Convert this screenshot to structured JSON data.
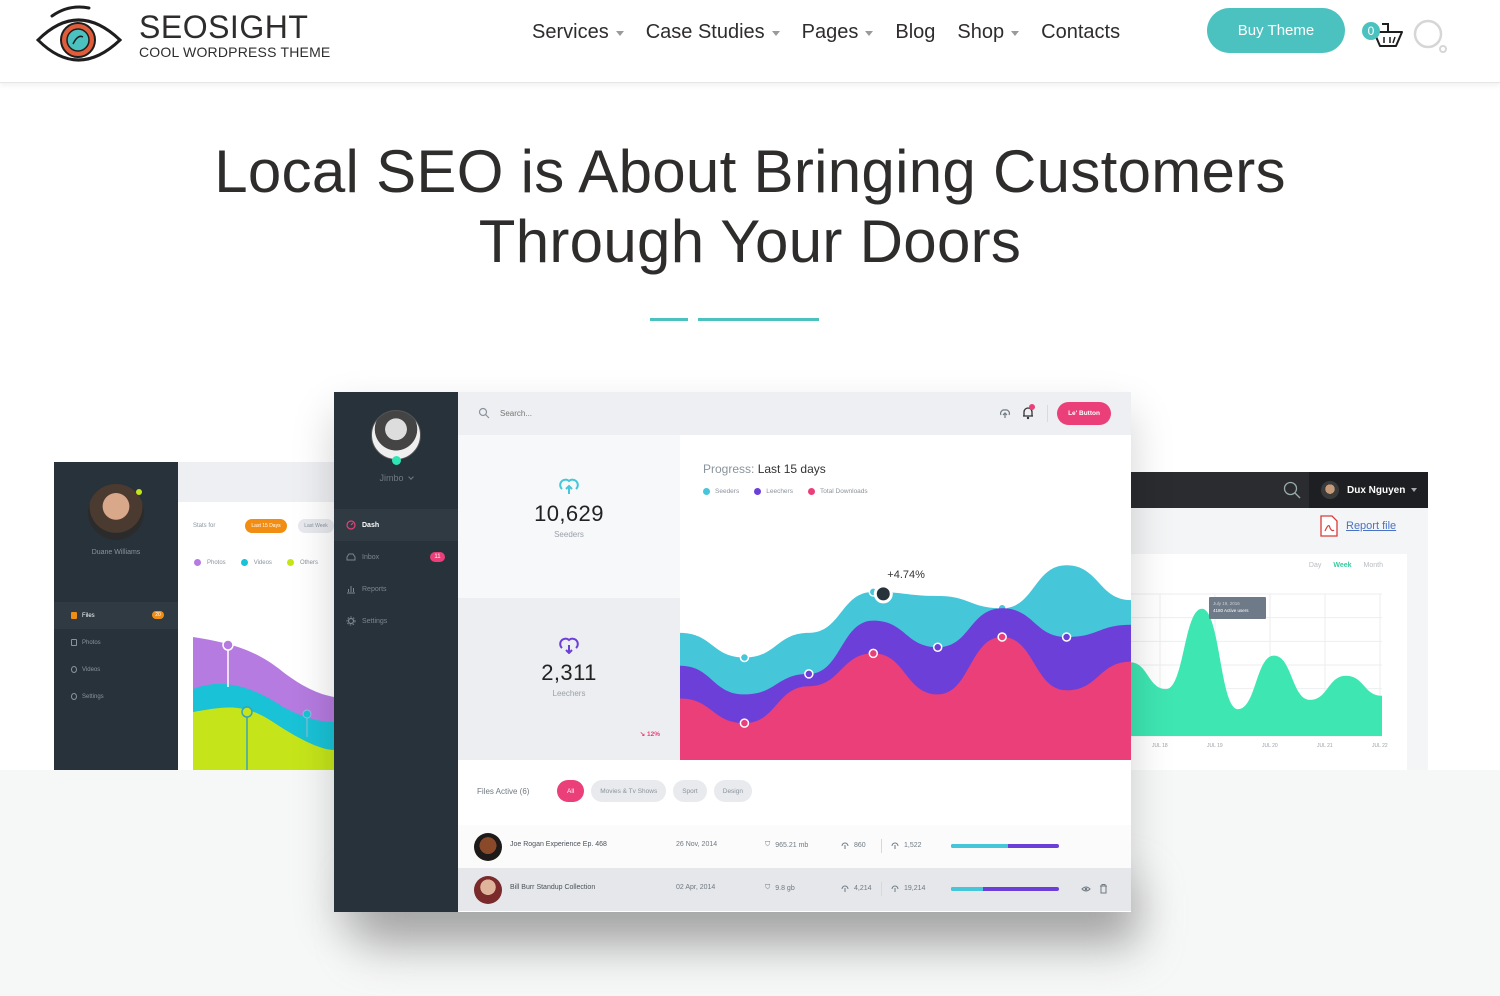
{
  "header": {
    "brand_title": "SEOSIGHT",
    "brand_subtitle": "COOL WORDPRESS THEME",
    "nav": [
      {
        "label": "Services",
        "has_dropdown": true
      },
      {
        "label": "Case Studies",
        "has_dropdown": true
      },
      {
        "label": "Pages",
        "has_dropdown": true
      },
      {
        "label": "Blog",
        "has_dropdown": false
      },
      {
        "label": "Shop",
        "has_dropdown": true
      },
      {
        "label": "Contacts",
        "has_dropdown": false
      }
    ],
    "buy_button": "Buy Theme",
    "cart_count": "0",
    "icons": {
      "cart": "basket-icon",
      "search": "search-icon",
      "logo": "eye-logo-icon"
    },
    "accent_color": "#4cc2c0"
  },
  "hero": {
    "title_line1": "Local SEO is About Bringing Customers",
    "title_line2": "Through Your Doors"
  },
  "left_mockup": {
    "user_name": "Duane Williams",
    "menu": [
      {
        "label": "Files",
        "badge": "20",
        "active": true
      },
      {
        "label": "Photos"
      },
      {
        "label": "Videos"
      },
      {
        "label": "Settings"
      }
    ],
    "stats_label": "Stats for",
    "pills": [
      "Last 15 Days",
      "Last Week"
    ],
    "legend": [
      {
        "label": "Photos",
        "color": "#b57be0"
      },
      {
        "label": "Videos",
        "color": "#19c2d6"
      },
      {
        "label": "Others",
        "color": "#c5e51a"
      }
    ]
  },
  "right_mockup": {
    "user_name": "Dux Nguyen",
    "report_link": "Report file",
    "tabs": [
      {
        "label": "Day",
        "active": false
      },
      {
        "label": "Week",
        "active": true
      },
      {
        "label": "Month",
        "active": false
      }
    ],
    "tooltip_date": "July 19, 2016",
    "tooltip_value": "4180 Active users",
    "x_labels": [
      "JUL 18",
      "JUL 19",
      "JUL 20",
      "JUL 21",
      "JUL 22"
    ],
    "series_color": "#3ee6b2",
    "active_users_relative": [
      0.55,
      0.35,
      0.95,
      0.2,
      0.6,
      0.27,
      0.45,
      0.3
    ]
  },
  "main_mockup": {
    "user_name": "Jimbo",
    "menu": [
      {
        "label": "Dash",
        "icon": "gauge-icon",
        "active": true
      },
      {
        "label": "Inbox",
        "icon": "inbox-icon",
        "badge": "11"
      },
      {
        "label": "Reports",
        "icon": "bar-chart-icon"
      },
      {
        "label": "Settings",
        "icon": "gear-icon"
      }
    ],
    "search_placeholder": "Search...",
    "action_button": "Le' Button",
    "stats": [
      {
        "value": "10,629",
        "label": "Seeders",
        "icon": "cloud-upload-icon",
        "color": "#45c6d9"
      },
      {
        "value": "2,311",
        "label": "Leechers",
        "icon": "cloud-download-icon",
        "color": "#6d3fd9",
        "trend": "12%",
        "trend_direction": "down"
      }
    ],
    "chart_title_prefix": "Progress:",
    "chart_title": "Last 15 days",
    "chart_legend": [
      {
        "label": "Seeders",
        "color": "#45c6d9"
      },
      {
        "label": "Leechers",
        "color": "#6d3fd9"
      },
      {
        "label": "Total Downloads",
        "color": "#ea3f78"
      }
    ],
    "chart_annotation": "+4.74%",
    "files_label": "Files Active (6)",
    "filters": [
      {
        "label": "All",
        "active": true
      },
      {
        "label": "Movies & Tv Shows",
        "active": false
      },
      {
        "label": "Sport",
        "active": false
      },
      {
        "label": "Design",
        "active": false
      }
    ],
    "files": [
      {
        "title": "Joe Rogan Experience Ep. 468",
        "date": "26 Nov, 2014",
        "size": "965.21 mb",
        "seeders": "860",
        "leechers": "1,522",
        "ratio": 0.53
      },
      {
        "title": "Bill Burr Standup Collection",
        "date": "02 Apr, 2014",
        "size": "9.8 gb",
        "seeders": "4,214",
        "leechers": "19,214",
        "ratio": 0.3
      }
    ]
  },
  "chart_data": [
    {
      "type": "area",
      "title": "Progress: Last 15 days",
      "legend_position": "top-left",
      "annotation": "+4.74%",
      "series": [
        {
          "name": "Seeders",
          "color": "#45c6d9",
          "values": [
            0.62,
            0.5,
            0.62,
            0.82,
            0.8,
            0.74,
            0.95,
            0.78
          ]
        },
        {
          "name": "Leechers",
          "color": "#6d3fd9",
          "values": [
            0.46,
            0.32,
            0.42,
            0.68,
            0.55,
            0.74,
            0.6,
            0.66
          ]
        },
        {
          "name": "Total Downloads",
          "color": "#ea3f78",
          "values": [
            0.3,
            0.18,
            0.36,
            0.52,
            0.32,
            0.6,
            0.34,
            0.48
          ]
        }
      ],
      "grid": false
    },
    {
      "type": "area",
      "title": "",
      "categories": [
        "JUL 18",
        "JUL 19",
        "JUL 20",
        "JUL 21",
        "JUL 22"
      ],
      "series": [
        {
          "name": "Active users",
          "values": [
            0.55,
            0.35,
            0.95,
            0.2,
            0.6,
            0.27,
            0.45,
            0.3
          ]
        }
      ],
      "annotation": "July 19, 2016 — 4180 Active users",
      "grid": true
    }
  ]
}
